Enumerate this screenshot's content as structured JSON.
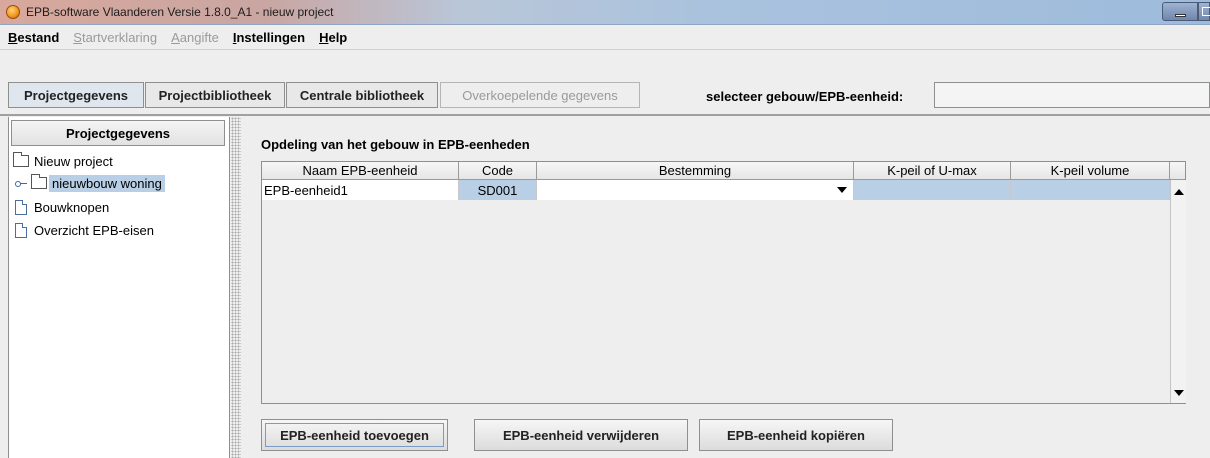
{
  "window": {
    "title": "EPB-software Vlaanderen Versie 1.8.0_A1 - nieuw project"
  },
  "menu": {
    "items": [
      {
        "label": "Bestand",
        "mnemonic": "B",
        "rest": "estand",
        "enabled": true
      },
      {
        "label": "Startverklaring",
        "mnemonic": "S",
        "rest": "tartverklaring",
        "enabled": false
      },
      {
        "label": "Aangifte",
        "mnemonic": "A",
        "rest": "angifte",
        "enabled": false
      },
      {
        "label": "Instellingen",
        "mnemonic": "I",
        "rest": "nstellingen",
        "enabled": true
      },
      {
        "label": "Help",
        "mnemonic": "H",
        "rest": "elp",
        "enabled": true
      }
    ]
  },
  "tabs": [
    {
      "label": "Projectgegevens",
      "active": true
    },
    {
      "label": "Projectbibliotheek",
      "active": false
    },
    {
      "label": "Centrale bibliotheek",
      "active": false
    },
    {
      "label": "Overkoepelende gegevens",
      "disabled": true
    }
  ],
  "selector": {
    "label": "selecteer gebouw/EPB-eenheid:",
    "value": ""
  },
  "sidebar": {
    "header": "Projectgegevens",
    "items": [
      {
        "label": "Nieuw project",
        "icon": "folder-icon"
      },
      {
        "label": "nieuwbouw woning",
        "icon": "folder-icon",
        "selected": true
      },
      {
        "label": "Bouwknopen",
        "icon": "document-icon"
      },
      {
        "label": "Overzicht EPB-eisen",
        "icon": "document-icon"
      }
    ]
  },
  "main": {
    "section_title": "Opdeling van het gebouw in EPB-eenheden",
    "table": {
      "columns": [
        "Naam EPB-eenheid",
        "Code",
        "Bestemming",
        "K-peil of U-max",
        "K-peil volume"
      ],
      "rows": [
        {
          "name": "EPB-eenheid1",
          "code": "SD001",
          "bestemming": "",
          "kpeil_umax": "",
          "kpeil_volume": ""
        }
      ]
    },
    "buttons": {
      "add": "EPB-eenheid toevoegen",
      "remove": "EPB-eenheid verwijderen",
      "copy": "EPB-eenheid kopiëren"
    }
  },
  "colors": {
    "selection": "#b8cfe5",
    "background": "#eeeeee"
  }
}
